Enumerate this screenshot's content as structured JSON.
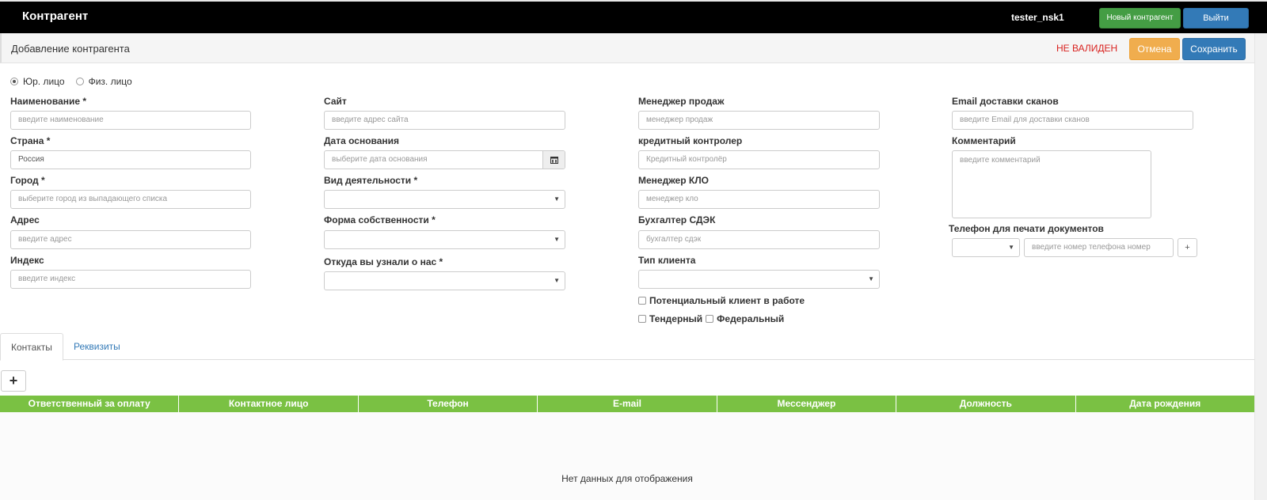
{
  "navbar": {
    "brand": "Контрагент",
    "username": "tester_nsk1",
    "new_button": "Новый контрагент",
    "exit_button": "Выйти"
  },
  "header": {
    "title": "Добавление контрагента",
    "status": "НЕ ВАЛИДЕН",
    "cancel_button": "Отмена",
    "save_button": "Сохранить"
  },
  "entity_type": {
    "options": [
      "Юр. лицо",
      "Физ. лицо"
    ],
    "selected": "Юр. лицо"
  },
  "form": {
    "name": {
      "label": "Наименование *",
      "placeholder": "введите наименование"
    },
    "country": {
      "label": "Страна *",
      "value": "Россия"
    },
    "city": {
      "label": "Город *",
      "placeholder": "выберите город из выпадающего списка"
    },
    "address": {
      "label": "Адрес",
      "placeholder": "введите адрес"
    },
    "index": {
      "label": "Индекс",
      "placeholder": "введите индекс"
    },
    "site": {
      "label": "Сайт",
      "placeholder": "введите адрес сайта"
    },
    "founded": {
      "label": "Дата основания",
      "placeholder": "выберите дата основания"
    },
    "activity": {
      "label": "Вид деятельности *",
      "value": ""
    },
    "ownership": {
      "label": "Форма собственности *",
      "value": ""
    },
    "source": {
      "label": "Откуда вы узнали о нас *",
      "value": ""
    },
    "sales_manager": {
      "label": "Менеджер продаж",
      "placeholder": "менеджер продаж"
    },
    "credit_controller": {
      "label": "кредитный контролер",
      "placeholder": "Кредитный контролёр"
    },
    "klo_manager": {
      "label": "Менеджер КЛО",
      "placeholder": "менеджер кло"
    },
    "accountant": {
      "label": "Бухгалтер СДЭК",
      "placeholder": "бухгалтер сдэк"
    },
    "client_type": {
      "label": "Тип клиента",
      "value": ""
    },
    "potential_client": "Потенциальный клиент в работе",
    "tender": "Тендерный",
    "federal": "Федеральный",
    "scan_email": {
      "label": "Email доставки сканов",
      "placeholder": "введите Email для доставки сканов"
    },
    "comment": {
      "label": "Комментарий",
      "placeholder": "введите комментарий"
    },
    "print_phone": {
      "label": "Телефон для печати документов",
      "placeholder": "введите номер телефона номер",
      "add": "+"
    }
  },
  "tabs": [
    "Контакты",
    "Реквизиты"
  ],
  "contacts": {
    "add_button": "+",
    "columns": [
      "Ответственный за оплату",
      "Контактное лицо",
      "Телефон",
      "E-mail",
      "Мессенджер",
      "Должность",
      "Дата рождения"
    ],
    "empty_text": "Нет данных для отображения"
  },
  "colors": {
    "accent_green": "#7ac143",
    "primary": "#337ab7",
    "warning": "#f0ad4e",
    "danger": "#d9221f"
  }
}
